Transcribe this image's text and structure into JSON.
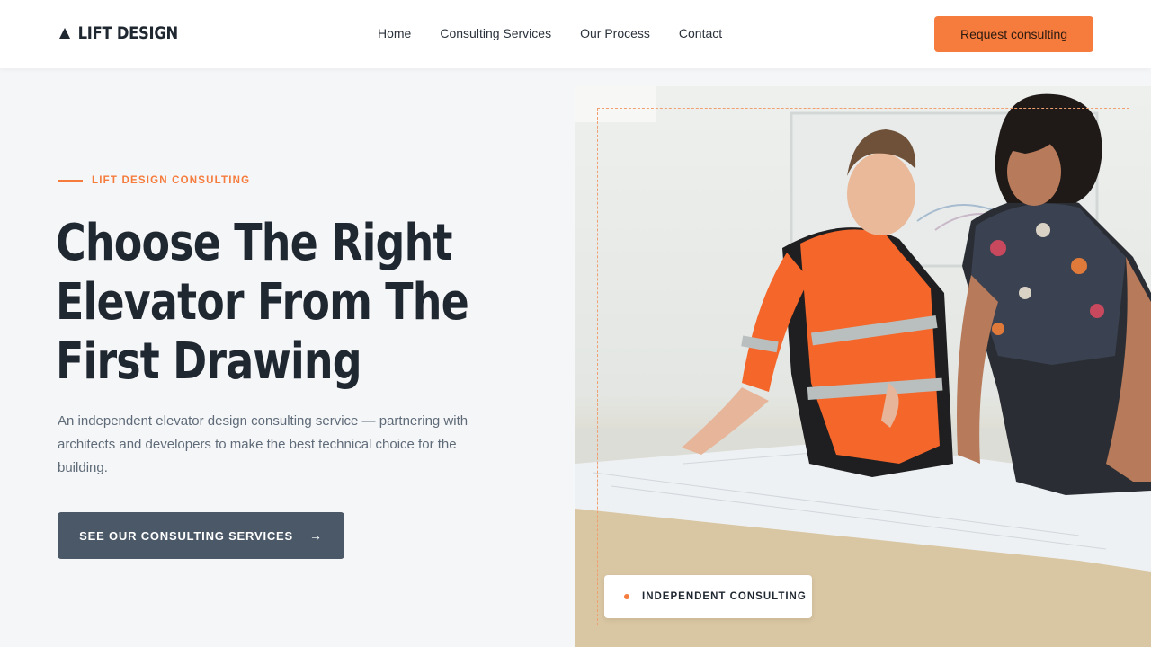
{
  "brand": {
    "name": "LIFT DESIGN",
    "icon": "triangle-logo-icon"
  },
  "nav": {
    "items": [
      {
        "label": "Home"
      },
      {
        "label": "Consulting Services"
      },
      {
        "label": "Our Process"
      },
      {
        "label": "Contact"
      }
    ],
    "cta_label": "Request consulting"
  },
  "hero": {
    "eyebrow": "LIFT DESIGN CONSULTING",
    "title_lines": [
      "Choose The Right",
      "Elevator From The",
      "First Drawing"
    ],
    "description": "An independent elevator design consulting service — partnering with architects and developers to make the best technical choice for the building.",
    "cta_label": "SEE OUR CONSULTING SERVICES",
    "cta_arrow": "→",
    "image_badge": "INDEPENDENT CONSULTING"
  },
  "colors": {
    "accent": "#f57c3d",
    "dark": "#1f2730",
    "button_dark": "#4b5868",
    "background": "#f5f6f8"
  }
}
